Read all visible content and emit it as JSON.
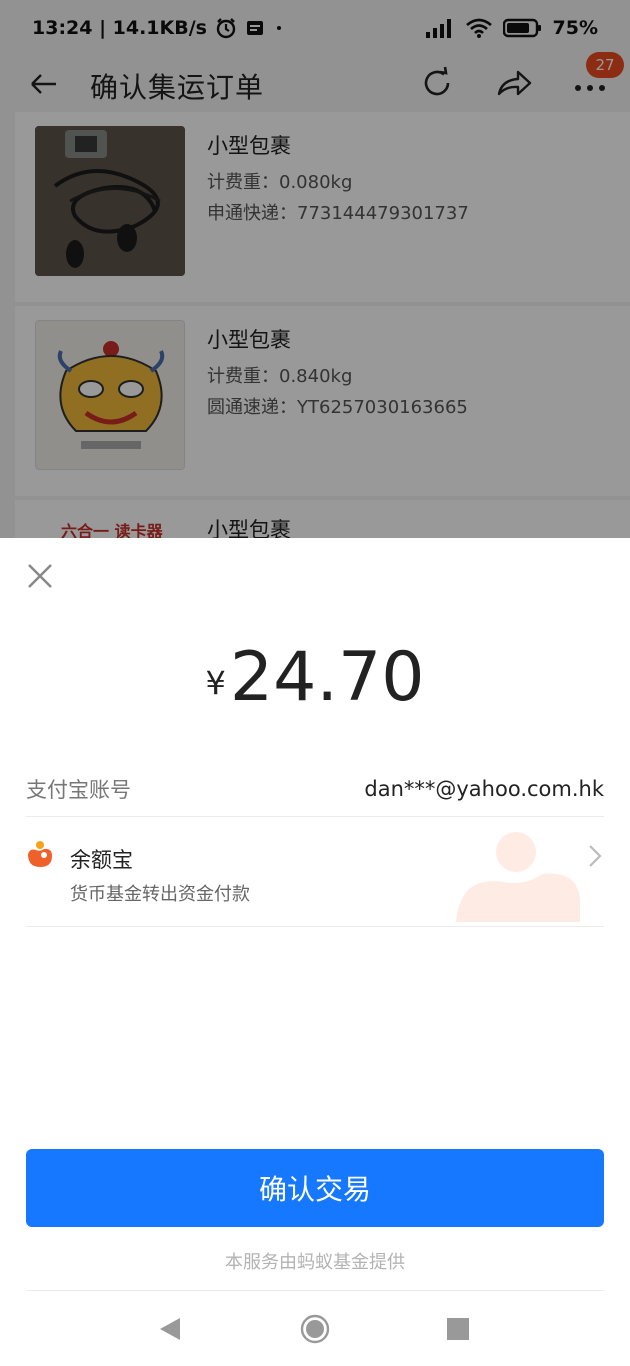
{
  "status": {
    "time_speed": "13:24 | 14.1KB/s",
    "battery": "75%"
  },
  "header": {
    "title": "确认集运订单",
    "badge_count": "27"
  },
  "packages": [
    {
      "title": "小型包裹",
      "weight": "计费重：0.080kg",
      "tracking": "申通快递：773144479301737"
    },
    {
      "title": "小型包裹",
      "weight": "计费重：0.840kg",
      "tracking": "圆通速递：YT6257030163665"
    },
    {
      "title": "小型包裹",
      "thumb_text": "六合一 读卡器"
    }
  ],
  "sheet": {
    "currency": "¥",
    "amount": "24.70",
    "account_label": "支付宝账号",
    "account_value": "dan***@yahoo.com.hk",
    "method_name": "余额宝",
    "method_sub": "货币基金转出资金付款",
    "confirm_label": "确认交易",
    "footer": "本服务由蚂蚁基金提供"
  },
  "colors": {
    "primary": "#1677ff",
    "badge": "#e84a20",
    "yuebao": "#f0602a"
  }
}
